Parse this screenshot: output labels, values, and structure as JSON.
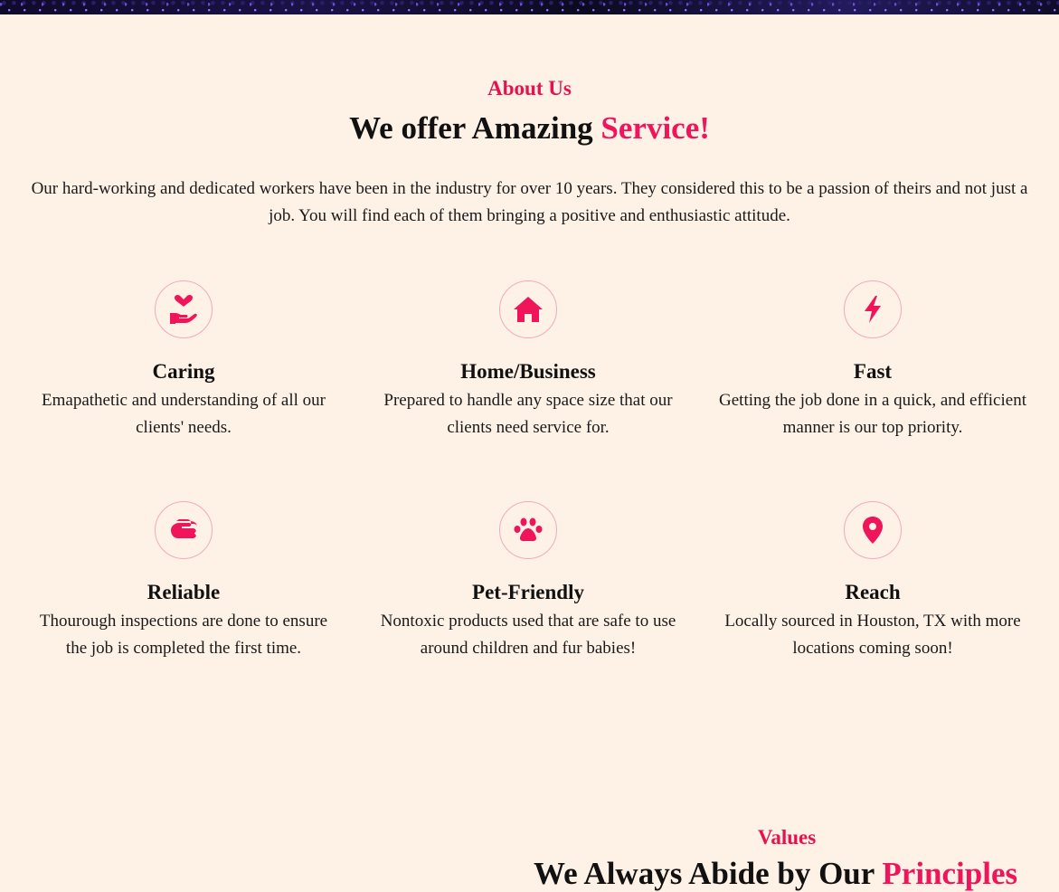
{
  "about": {
    "eyebrow": "About Us",
    "headline_main": "We offer Amazing ",
    "headline_accent": "Service!",
    "intro": "Our hard-working and dedicated workers have been in the industry for over 10 years. They considered this to be a passion of theirs and not just a job. You will find each of them bringing a positive and enthusiastic attitude."
  },
  "features": [
    {
      "icon": "hand-heart-icon",
      "title": "Caring",
      "text": "Emapathetic and understanding of all our clients' needs."
    },
    {
      "icon": "home-icon",
      "title": "Home/Business",
      "text": "Prepared to handle any space size that our clients need service for."
    },
    {
      "icon": "lightning-icon",
      "title": "Fast",
      "text": "Getting the job done in a quick, and efficient manner is our top priority."
    },
    {
      "icon": "handshake-icon",
      "title": "Reliable",
      "text": "Thourough inspections are done to ensure the job is completed the first time."
    },
    {
      "icon": "paw-icon",
      "title": "Pet-Friendly",
      "text": "Nontoxic products used that are safe to use around children and fur babies!"
    },
    {
      "icon": "map-pin-icon",
      "title": "Reach",
      "text": "Locally sourced in Houston, TX with more locations coming soon!"
    }
  ],
  "values": {
    "eyebrow": "Values",
    "headline_main": "We Always Abide by Our ",
    "headline_accent": "Principles"
  },
  "colors": {
    "background": "#fef1e6",
    "accent": "#f0145a",
    "icon_ring": "#f5a9bf"
  }
}
